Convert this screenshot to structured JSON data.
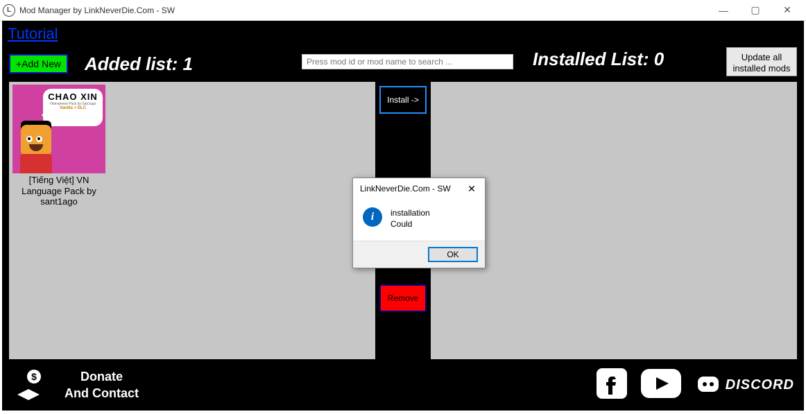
{
  "window": {
    "title": "Mod Manager by LinkNeverDie.Com - SW",
    "min": "—",
    "max": "▢",
    "close": "✕"
  },
  "tutorial_link": "Tutorial",
  "toolbar": {
    "add_new": "+Add New",
    "added_list_label": "Added list:  1",
    "search_placeholder": "Press mod id or mod name to search ...",
    "installed_list_label": "Installed List:  0",
    "update_all": "Update all installed mods"
  },
  "actions": {
    "install": "Install ->",
    "remove": "Remove"
  },
  "mods": {
    "item1": {
      "bubble_title": "CHAO XIN",
      "bubble_sub": "Vietnamese Pack by San1ago",
      "bubble_tag": "Vanilla + DLC",
      "caption": "[Tiếng Việt] VN Language Pack by sant1ago"
    }
  },
  "footer": {
    "donate_line1": "Donate",
    "donate_line2": "And Contact",
    "discord_text": "DISCORD"
  },
  "dialog": {
    "title": "LinkNeverDie.Com - SW",
    "icon_glyph": "i",
    "message_line1": "installation",
    "message_line2": "Could",
    "ok": "OK",
    "close": "✕"
  }
}
